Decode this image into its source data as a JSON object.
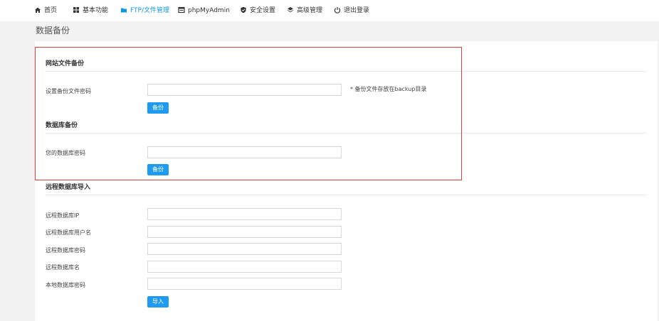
{
  "nav": {
    "items": [
      {
        "label": "首页",
        "icon": "home-icon"
      },
      {
        "label": "基本功能",
        "icon": "grid-icon"
      },
      {
        "label": "FTP/文件管理",
        "icon": "folder-icon"
      },
      {
        "label": "phpMyAdmin",
        "icon": "database-window-icon"
      },
      {
        "label": "安全设置",
        "icon": "shield-icon"
      },
      {
        "label": "高级管理",
        "icon": "layers-icon"
      },
      {
        "label": "退出登录",
        "icon": "power-icon"
      }
    ],
    "active_index": 2
  },
  "page": {
    "title": "数据备份"
  },
  "site_backup": {
    "title": "网站文件备份",
    "password_label": "设置备份文件密码",
    "password_value": "",
    "hint": "* 备份文件存放在backup目录",
    "button": "备份"
  },
  "db_backup": {
    "title": "数据库备份",
    "password_label": "您的数据库密码",
    "password_value": "",
    "button": "备份"
  },
  "remote_import": {
    "title": "远程数据库导入",
    "fields": [
      {
        "label": "远程数据库IP",
        "value": ""
      },
      {
        "label": "远程数据库用户名",
        "value": ""
      },
      {
        "label": "远程数据库密码",
        "value": ""
      },
      {
        "label": "远程数据库名",
        "value": ""
      },
      {
        "label": "本地数据库密码",
        "value": ""
      }
    ],
    "button": "导入"
  },
  "colors": {
    "accent": "#1e9bf0",
    "nav_active": "#1296db",
    "highlight_border": "#e63d3d",
    "page_bg": "#f2f2f2"
  }
}
